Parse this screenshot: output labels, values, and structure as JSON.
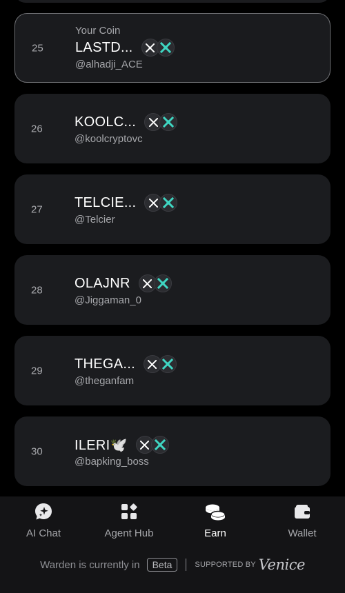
{
  "leaderboard": {
    "your_coin_label": "Your Coin",
    "items": [
      {
        "rank": "25",
        "name": "LASTD...",
        "handle": "@alhadji_ACE"
      },
      {
        "rank": "26",
        "name": "KOOLC...",
        "handle": "@koolcryptovc"
      },
      {
        "rank": "27",
        "name": "TELCIE...",
        "handle": "@Telcier"
      },
      {
        "rank": "28",
        "name": "OLAJNR",
        "handle": "@Jiggaman_0"
      },
      {
        "rank": "29",
        "name": "THEGA...",
        "handle": "@theganfam"
      },
      {
        "rank": "30",
        "name": "ILERI🕊️",
        "handle": "@bapking_boss"
      }
    ]
  },
  "badges": {
    "x": "x-icon",
    "second": "cross-logo-icon",
    "second_color": "#3fd6c2"
  },
  "nav": {
    "items": [
      {
        "label": "AI Chat",
        "icon": "ai-chat-icon"
      },
      {
        "label": "Agent Hub",
        "icon": "agent-hub-icon"
      },
      {
        "label": "Earn",
        "icon": "coins-icon"
      },
      {
        "label": "Wallet",
        "icon": "wallet-icon"
      }
    ],
    "active": "Earn"
  },
  "footer": {
    "status_text": "Warden is currently in",
    "beta_label": "Beta",
    "supported_label": "SUPPORTED BY",
    "partner": "Venice"
  }
}
